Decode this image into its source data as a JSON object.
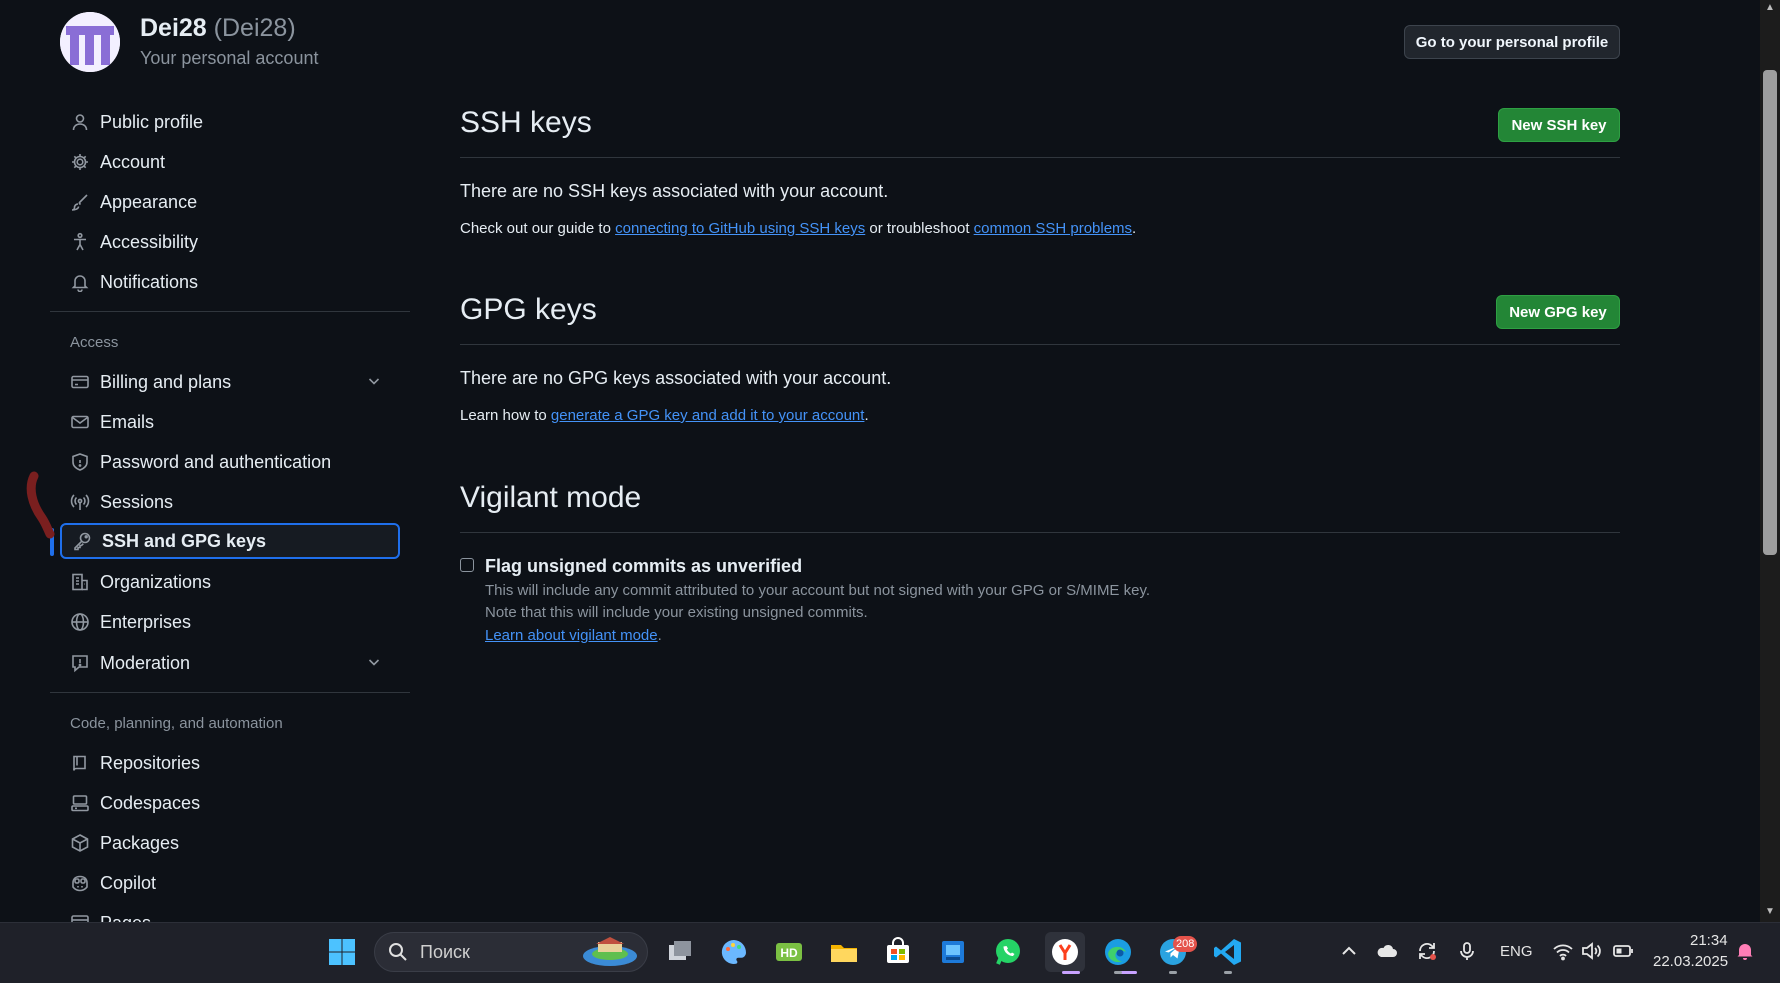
{
  "account": {
    "name": "Dei28",
    "login": "(Dei28)",
    "subtitle": "Your personal account",
    "profile_button": "Go to your personal profile"
  },
  "sidebar": {
    "items_top": [
      {
        "label": "Public profile",
        "icon": "person-icon"
      },
      {
        "label": "Account",
        "icon": "gear-icon"
      },
      {
        "label": "Appearance",
        "icon": "paintbrush-icon"
      },
      {
        "label": "Accessibility",
        "icon": "accessibility-icon"
      },
      {
        "label": "Notifications",
        "icon": "bell-icon"
      }
    ],
    "group_access": "Access",
    "items_access": [
      {
        "label": "Billing and plans",
        "icon": "credit-card-icon"
      },
      {
        "label": "Emails",
        "icon": "mail-icon"
      },
      {
        "label": "Password and authentication",
        "icon": "shield-icon"
      },
      {
        "label": "Sessions",
        "icon": "broadcast-icon"
      },
      {
        "label": "SSH and GPG keys",
        "icon": "key-icon"
      },
      {
        "label": "Organizations",
        "icon": "organization-icon"
      },
      {
        "label": "Enterprises",
        "icon": "globe-icon"
      },
      {
        "label": "Moderation",
        "icon": "report-icon"
      }
    ],
    "group_code": "Code, planning, and automation",
    "items_code": [
      {
        "label": "Repositories",
        "icon": "repo-icon"
      },
      {
        "label": "Codespaces",
        "icon": "codespaces-icon"
      },
      {
        "label": "Packages",
        "icon": "package-icon"
      },
      {
        "label": "Copilot",
        "icon": "copilot-icon"
      },
      {
        "label": "Pages",
        "icon": "browser-icon"
      }
    ]
  },
  "ssh": {
    "title": "SSH keys",
    "button": "New SSH key",
    "empty": "There are no SSH keys associated with your account.",
    "help_pre": "Check out our guide to ",
    "help_link1": "connecting to GitHub using SSH keys",
    "help_mid": " or troubleshoot ",
    "help_link2": "common SSH problems",
    "help_post": "."
  },
  "gpg": {
    "title": "GPG keys",
    "button": "New GPG key",
    "empty": "There are no GPG keys associated with your account.",
    "help_pre": "Learn how to ",
    "help_link": "generate a GPG key and add it to your account",
    "help_post": "."
  },
  "vigilant": {
    "title": "Vigilant mode",
    "checkbox_label": "Flag unsigned commits as unverified",
    "checked": false,
    "note1": "This will include any commit attributed to your account but not signed with your GPG or S/MIME key.",
    "note2": "Note that this will include your existing unsigned commits.",
    "link": "Learn about vigilant mode",
    "link_post": "."
  },
  "taskbar": {
    "search_placeholder": "Поиск",
    "telegram_badge": "208",
    "language": "ENG",
    "time": "21:34",
    "date": "22.03.2025"
  },
  "colors": {
    "background": "#0d1117",
    "accent": "#1f6feb",
    "green_button": "#238636",
    "link": "#4493f8"
  }
}
